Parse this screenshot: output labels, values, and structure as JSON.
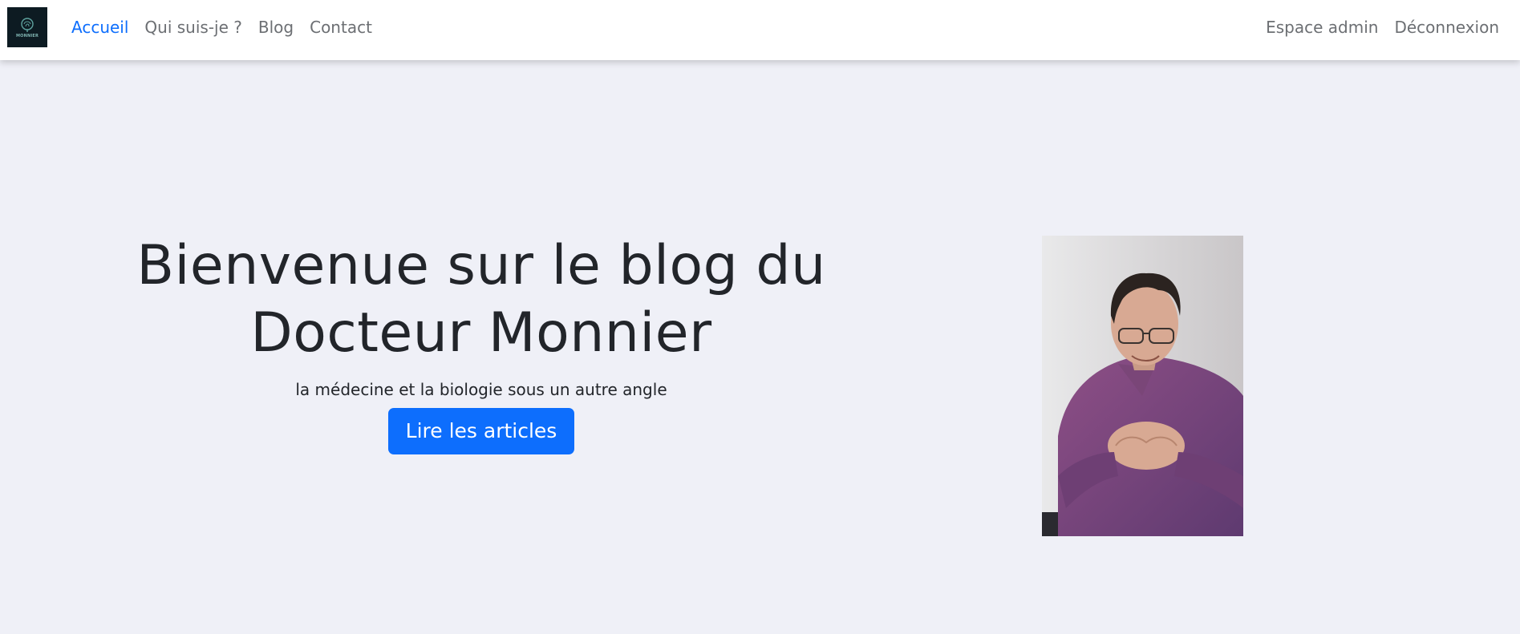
{
  "nav": {
    "logo_text": "MONNIER",
    "left_links": [
      {
        "label": "Accueil",
        "active": true
      },
      {
        "label": "Qui suis-je ?",
        "active": false
      },
      {
        "label": "Blog",
        "active": false
      },
      {
        "label": "Contact",
        "active": false
      }
    ],
    "right_links": [
      {
        "label": "Espace admin"
      },
      {
        "label": "Déconnexion"
      }
    ]
  },
  "hero": {
    "title_line1": "Bienvenue sur le blog du",
    "title_line2": "Docteur Monnier",
    "subtitle": "la médecine et la biologie sous un autre angle",
    "button_label": "Lire les articles"
  },
  "colors": {
    "accent": "#0d6efd",
    "background": "#eff0f7",
    "navbar": "#ffffff",
    "text": "#22252a",
    "nav_text": "#6c6f73"
  },
  "icons": {
    "logo": "brain-logo-icon"
  }
}
